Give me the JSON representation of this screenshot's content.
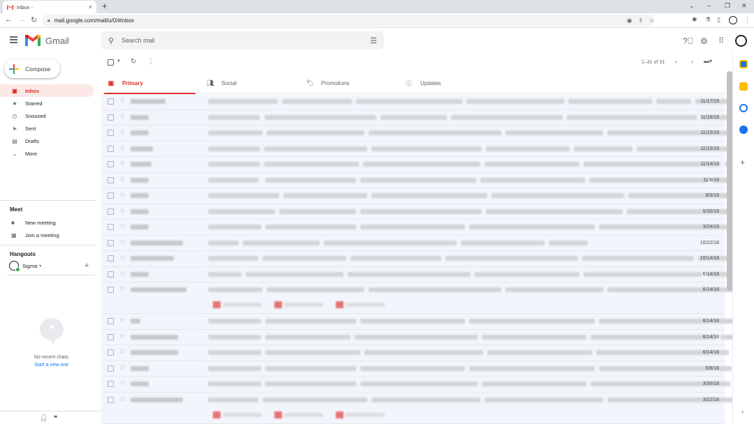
{
  "browser": {
    "tab_title": "Inbox -",
    "tab_close": "×",
    "new_tab": "+",
    "url": "mail.google.com/mail/u/0/#inbox",
    "win_minimize": "⌄",
    "win_min": "–",
    "win_restore": "❐",
    "win_close": "✕"
  },
  "header": {
    "app_name": "Gmail",
    "search_placeholder": "Search mail"
  },
  "compose": {
    "label": "Compose"
  },
  "nav": {
    "items": [
      {
        "label": "Inbox",
        "icon": "inbox-icon",
        "active": true
      },
      {
        "label": "Starred",
        "icon": "star-icon"
      },
      {
        "label": "Snoozed",
        "icon": "clock-icon"
      },
      {
        "label": "Sent",
        "icon": "send-icon"
      },
      {
        "label": "Drafts",
        "icon": "draft-icon"
      },
      {
        "label": "More",
        "icon": "chevron-down-icon"
      }
    ]
  },
  "meet": {
    "title": "Meet",
    "new_meeting": "New meeting",
    "join_meeting": "Join a meeting"
  },
  "hangouts": {
    "title": "Hangouts",
    "user": "Sigma",
    "user_caret": "▾",
    "no_chats": "No recent chats",
    "start_new": "Start a new one"
  },
  "toolbar": {
    "pager": "1–31 of 31"
  },
  "category_tabs": [
    {
      "label": "Primary",
      "icon": "inbox-icon",
      "active": true
    },
    {
      "label": "Social",
      "icon": "people-icon"
    },
    {
      "label": "Promotions",
      "icon": "tag-icon"
    },
    {
      "label": "Updates",
      "icon": "info-icon"
    }
  ],
  "emails": [
    {
      "date": "11/17/19"
    },
    {
      "date": "11/16/19"
    },
    {
      "date": "11/15/19"
    },
    {
      "date": "11/15/19"
    },
    {
      "date": "11/14/19"
    },
    {
      "date": "11/6/19"
    },
    {
      "date": "9/3/19"
    },
    {
      "date": "5/30/19"
    },
    {
      "date": "3/24/19"
    },
    {
      "date": "10/22/18"
    },
    {
      "date": "10/14/18"
    },
    {
      "date": "6/14/18"
    },
    {
      "date": "6/14/18",
      "attachments": 3
    },
    {
      "date": "6/14/18"
    },
    {
      "date": "6/14/18"
    },
    {
      "date": "6/14/18"
    },
    {
      "date": "5/8/18"
    },
    {
      "date": "3/30/18"
    },
    {
      "date": "3/22/18",
      "attachments": 3
    }
  ],
  "colors": {
    "accent_red": "#d93025",
    "active_bg": "#fce8e6",
    "read_row_bg": "#f2f6fc"
  }
}
